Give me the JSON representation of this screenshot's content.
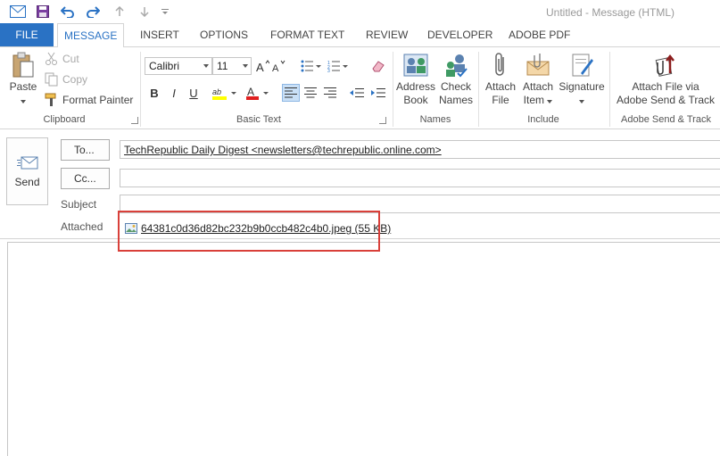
{
  "window": {
    "title": "Untitled - Message (HTML)"
  },
  "tabs": [
    {
      "label": "FILE"
    },
    {
      "label": "MESSAGE"
    },
    {
      "label": "INSERT"
    },
    {
      "label": "OPTIONS"
    },
    {
      "label": "FORMAT TEXT"
    },
    {
      "label": "REVIEW"
    },
    {
      "label": "DEVELOPER"
    },
    {
      "label": "ADOBE PDF"
    }
  ],
  "ribbon": {
    "clipboard": {
      "label": "Clipboard",
      "paste": "Paste",
      "cut": "Cut",
      "copy": "Copy",
      "format_painter": "Format Painter"
    },
    "basic_text": {
      "label": "Basic Text",
      "font": "Calibri",
      "size": "11",
      "bold": "B",
      "italic": "I",
      "underline": "U"
    },
    "names": {
      "label": "Names",
      "address_book_1": "Address",
      "address_book_2": "Book",
      "check_names_1": "Check",
      "check_names_2": "Names"
    },
    "include": {
      "label": "Include",
      "attach_file_1": "Attach",
      "attach_file_2": "File",
      "attach_item_1": "Attach",
      "attach_item_2": "Item",
      "signature": "Signature"
    },
    "adobe": {
      "label": "Adobe Send & Track",
      "btn_1": "Attach File via",
      "btn_2": "Adobe Send & Track"
    }
  },
  "message": {
    "send_label": "Send",
    "to_label": "To...",
    "cc_label": "Cc...",
    "subject_label": "Subject",
    "attached_label": "Attached",
    "to_value": "TechRepublic Daily Digest <newsletters@techrepublic.online.com>",
    "cc_value": "",
    "subject_value": "",
    "attachment": "64381c0d36d82bc232b9b0ccb482c4b0.jpeg (55 KB)"
  },
  "colors": {
    "accent": "#2a72c4",
    "highlight": "#d9403a",
    "highlighter_yellow": "#ffff00",
    "font_red": "#e02020"
  }
}
